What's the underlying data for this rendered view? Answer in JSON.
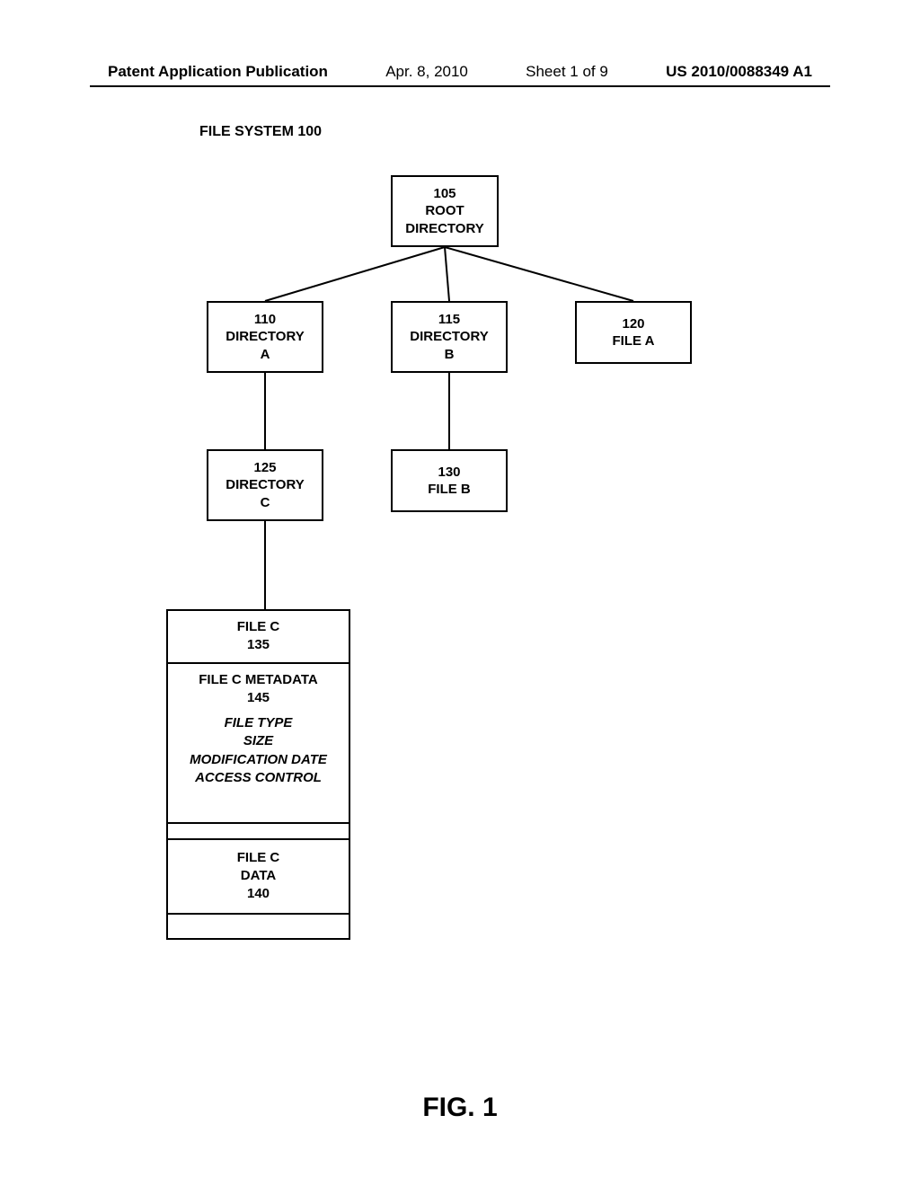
{
  "header": {
    "left": "Patent Application Publication",
    "center_date": "Apr. 8, 2010",
    "center_sheet": "Sheet 1 of 9",
    "right": "US 2010/0088349 A1"
  },
  "fs_title": "FILE SYSTEM 100",
  "nodes": {
    "root": {
      "num": "105",
      "l1": "ROOT",
      "l2": "DIRECTORY"
    },
    "dir_a": {
      "num": "110",
      "l1": "DIRECTORY",
      "l2": "A"
    },
    "dir_b": {
      "num": "115",
      "l1": "DIRECTORY",
      "l2": "B"
    },
    "file_a": {
      "num": "120",
      "l1": "FILE A"
    },
    "dir_c": {
      "num": "125",
      "l1": "DIRECTORY",
      "l2": "C"
    },
    "file_b": {
      "num": "130",
      "l1": "FILE B"
    }
  },
  "filec": {
    "title": "FILE C",
    "title_num": "135",
    "meta_title": "FILE C METADATA",
    "meta_num": "145",
    "meta_fields": {
      "f1": "FILE TYPE",
      "f2": "SIZE",
      "f3": "MODIFICATION DATE",
      "f4": "ACCESS CONTROL"
    },
    "data_title": "FILE C",
    "data_sub": "DATA",
    "data_num": "140"
  },
  "fig_label": "FIG. 1",
  "chart_data": {
    "type": "tree",
    "title": "FILE SYSTEM 100",
    "nodes": [
      {
        "id": "105",
        "label": "ROOT DIRECTORY",
        "children": [
          "110",
          "115",
          "120"
        ]
      },
      {
        "id": "110",
        "label": "DIRECTORY A",
        "children": [
          "125"
        ]
      },
      {
        "id": "115",
        "label": "DIRECTORY B",
        "children": [
          "130"
        ]
      },
      {
        "id": "120",
        "label": "FILE A",
        "children": []
      },
      {
        "id": "125",
        "label": "DIRECTORY C",
        "children": [
          "135"
        ]
      },
      {
        "id": "130",
        "label": "FILE B",
        "children": []
      },
      {
        "id": "135",
        "label": "FILE C",
        "children": [
          "145",
          "140"
        ]
      },
      {
        "id": "145",
        "label": "FILE C METADATA",
        "fields": [
          "FILE TYPE",
          "SIZE",
          "MODIFICATION DATE",
          "ACCESS CONTROL"
        ]
      },
      {
        "id": "140",
        "label": "FILE C DATA"
      }
    ]
  }
}
